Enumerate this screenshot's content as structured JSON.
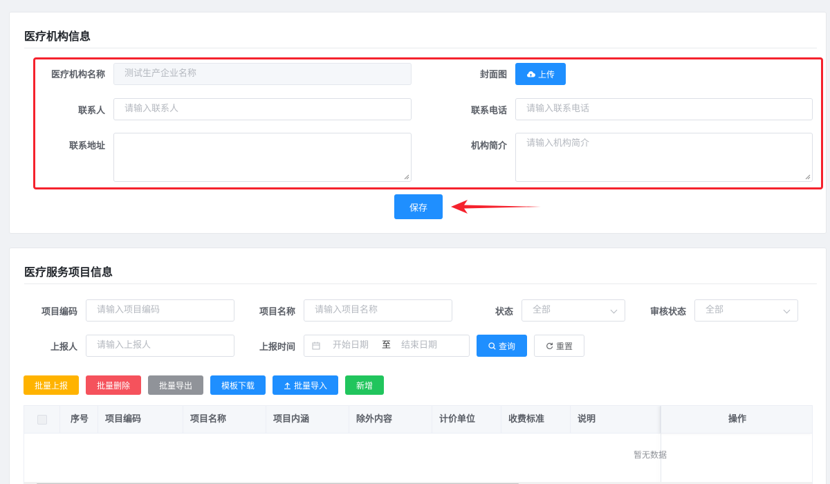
{
  "institution_section": {
    "title": "医疗机构信息",
    "form": {
      "name_label": "医疗机构名称",
      "name_value": "测试生产企业名称",
      "cover_label": "封面图",
      "upload_label": "上传",
      "contact_label": "联系人",
      "contact_placeholder": "请输入联系人",
      "phone_label": "联系电话",
      "phone_placeholder": "请输入联系电话",
      "address_label": "联系地址",
      "address_placeholder": "",
      "intro_label": "机构简介",
      "intro_placeholder": "请输入机构简介"
    },
    "save_label": "保存"
  },
  "service_section": {
    "title": "医疗服务项目信息",
    "filters": {
      "code_label": "项目编码",
      "code_placeholder": "请输入项目编码",
      "name_label": "项目名称",
      "name_placeholder": "请输入项目名称",
      "status_label": "状态",
      "status_value": "全部",
      "audit_label": "审核状态",
      "audit_value": "全部",
      "reporter_label": "上报人",
      "reporter_placeholder": "请输入上报人",
      "time_label": "上报时间",
      "start_placeholder": "开始日期",
      "range_sep": "至",
      "end_placeholder": "结束日期",
      "query_label": "查询",
      "reset_label": "重置"
    },
    "actions": {
      "batch_report": "批量上报",
      "batch_delete": "批量删除",
      "batch_export": "批量导出",
      "template_download": "模板下载",
      "batch_import": "批量导入",
      "add": "新增"
    },
    "table": {
      "columns": [
        "序号",
        "项目编码",
        "项目名称",
        "项目内涵",
        "除外内容",
        "计价单位",
        "收费标准",
        "说明",
        "操作"
      ],
      "empty_text": "暂无数据"
    }
  },
  "colors": {
    "primary": "#1f8fff",
    "warning": "#ffb300",
    "danger": "#f5525c",
    "info": "#909399",
    "success": "#21c55d",
    "highlight": "#f5222d"
  }
}
